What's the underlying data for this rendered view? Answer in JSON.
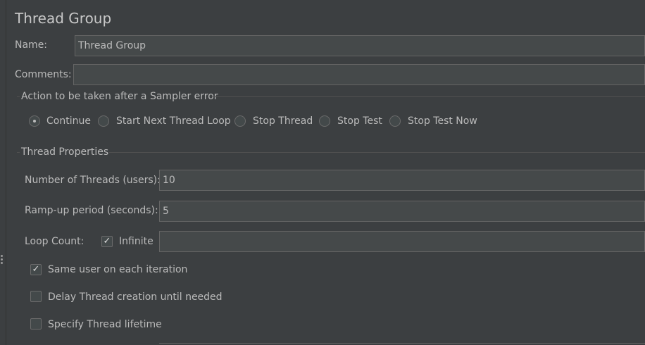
{
  "title": "Thread Group",
  "name": {
    "label": "Name:",
    "value": "Thread Group"
  },
  "comments": {
    "label": "Comments:",
    "value": ""
  },
  "sampler_error": {
    "legend": "Action to be taken after a Sampler error",
    "options": [
      {
        "label": "Continue",
        "selected": true
      },
      {
        "label": "Start Next Thread Loop",
        "selected": false
      },
      {
        "label": "Stop Thread",
        "selected": false
      },
      {
        "label": "Stop Test",
        "selected": false
      },
      {
        "label": "Stop Test Now",
        "selected": false
      }
    ]
  },
  "thread_props": {
    "legend": "Thread Properties",
    "threads": {
      "label": "Number of Threads (users):",
      "value": "10"
    },
    "rampup": {
      "label": "Ramp-up period (seconds):",
      "value": "5"
    },
    "loop": {
      "label": "Loop Count:",
      "infinite_label": "Infinite",
      "infinite_checked": true,
      "value": ""
    },
    "same_user": {
      "label": "Same user on each iteration",
      "checked": true
    },
    "delay": {
      "label": "Delay Thread creation until needed",
      "checked": false
    },
    "lifetime": {
      "label": "Specify Thread lifetime",
      "checked": false
    }
  },
  "icons": {
    "check": "check-icon",
    "grip": "drag-grip-icon"
  },
  "colors": {
    "background": "#3c3f41",
    "field": "#45494a",
    "text": "#bbbbbb"
  }
}
